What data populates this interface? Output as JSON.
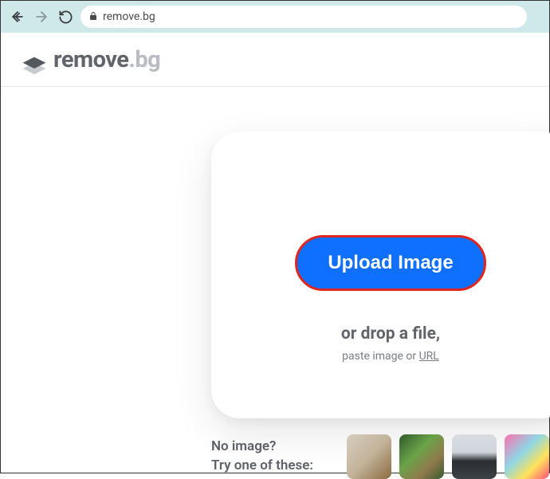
{
  "browser": {
    "url": "remove.bg"
  },
  "logo": {
    "text_main": "remove",
    "text_suffix": ".bg"
  },
  "upload": {
    "button_label": "Upload Image",
    "drop_label": "or drop a file,",
    "paste_prefix": "paste image or ",
    "url_label": "URL"
  },
  "samples": {
    "prompt_line1": "No image?",
    "prompt_line2": "Try one of these:"
  }
}
